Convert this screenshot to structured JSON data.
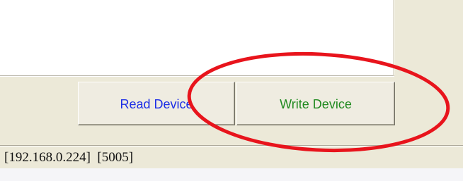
{
  "buttons": {
    "read_label": "Read Device",
    "write_label": "Write Device"
  },
  "status_bar": {
    "connection": "[192.168.0.224]  [5005]"
  },
  "colors": {
    "read_label": "#1c2ee6",
    "write_label": "#208a20",
    "annotation_circle": "#e8141c",
    "window_face": "#ece9d8"
  }
}
